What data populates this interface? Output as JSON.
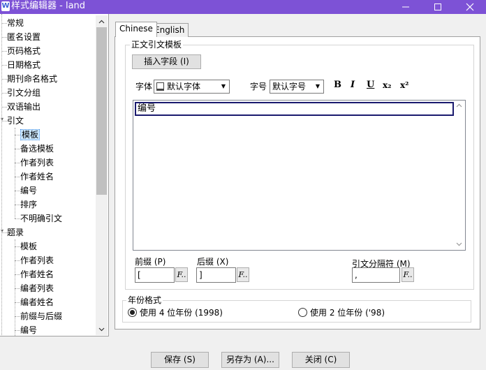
{
  "window": {
    "title": "样式编辑器 - land",
    "app_icon_glyph": "W",
    "icons": [
      "minimize-icon",
      "maximize-icon",
      "close-icon"
    ]
  },
  "tree": {
    "items": [
      {
        "label": "常规",
        "level": 0
      },
      {
        "label": "匿名设置",
        "level": 0
      },
      {
        "label": "页码格式",
        "level": 0
      },
      {
        "label": "日期格式",
        "level": 0
      },
      {
        "label": "期刊命名格式",
        "level": 0
      },
      {
        "label": "引文分组",
        "level": 0
      },
      {
        "label": "双语输出",
        "level": 0
      },
      {
        "label": "引文",
        "level": 0,
        "expanded": true
      },
      {
        "label": "模板",
        "level": 1,
        "selected": true
      },
      {
        "label": "备选模板",
        "level": 1
      },
      {
        "label": "作者列表",
        "level": 1
      },
      {
        "label": "作者姓名",
        "level": 1
      },
      {
        "label": "编号",
        "level": 1
      },
      {
        "label": "排序",
        "level": 1
      },
      {
        "label": "不明确引文",
        "level": 1
      },
      {
        "label": "题录",
        "level": 0,
        "expanded": true
      },
      {
        "label": "模板",
        "level": 1
      },
      {
        "label": "作者列表",
        "level": 1
      },
      {
        "label": "作者姓名",
        "level": 1
      },
      {
        "label": "编者列表",
        "level": 1
      },
      {
        "label": "编者姓名",
        "level": 1
      },
      {
        "label": "前缀与后缀",
        "level": 1
      },
      {
        "label": "编号",
        "level": 1
      }
    ]
  },
  "tabs": [
    {
      "label": "Chinese",
      "active": true
    },
    {
      "label": "English",
      "active": false
    }
  ],
  "template_group": {
    "title": "正文引文模板",
    "insert_field_label": "插入字段 (I)",
    "font_label": "字体",
    "font_value": "默认字体",
    "size_label": "字号",
    "size_value": "默认字号",
    "format_buttons": {
      "bold": "B",
      "italic": "I",
      "underline": "U",
      "subscript": "x₂",
      "superscript": "x²"
    },
    "editor_text": "编号",
    "prefix_label": "前缀 (P)",
    "prefix_value": "[",
    "suffix_label": "后缀 (X)",
    "suffix_value": "]",
    "separator_label": "引文分隔符 (M)",
    "separator_value": ",",
    "f_button_label": "F.."
  },
  "year_group": {
    "title": "年份格式",
    "option_4": "使用 4 位年份 (1998)",
    "option_2": "使用 2 位年份 ('98)",
    "selected": "option_4"
  },
  "footer": {
    "save_label": "保存 (S)",
    "save_as_label": "另存为 (A)...",
    "close_label": "关闭 (C)"
  }
}
